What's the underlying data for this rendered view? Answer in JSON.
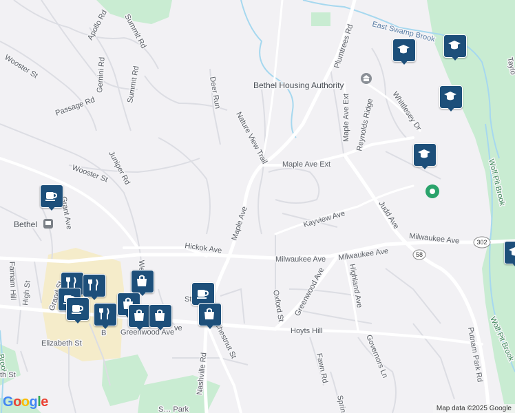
{
  "map": {
    "street_labels": {
      "plumtrees_rd": "Plumtrees Rd",
      "east_swamp_brook": "East Swamp Brook",
      "taylor_rd": "Taylo",
      "apollo_rd": "Apollo Rd",
      "summit_rd_1": "Summit Rd",
      "summit_rd_2": "Summit Rd",
      "gemini_rd": "Gemini Rd",
      "wooster_st_1": "Wooster St",
      "passage_rd": "Passage Rd",
      "deer_run": "Deer Run",
      "nature_view_trail": "Nature View Trail",
      "maple_ave_ext_1": "Maple Ave Ext",
      "maple_ave_ext_2": "Maple Ave Ext",
      "reynolds_ridge": "Reynolds Ridge",
      "whittlesey_dr": "Whittlesey Dr",
      "juniper_rd": "Juniper Rd",
      "wooster_st_2": "Wooster St",
      "grant_ave": "Grant Ave",
      "maple_ave": "Maple Ave",
      "kayview_ave": "Kayview Ave",
      "judd_ave": "Judd Ave",
      "wolf_pit_brook_1": "Wolf Pit Brook",
      "wolf_pit_brook_2": "Wolf Pit Brook",
      "hickok_ave": "Hickok Ave",
      "milwaukee_ave_1": "Milwaukee Ave",
      "milwaukee_ave_2": "Milwaukee Ave",
      "milwaukee_ave_3": "Milwaukee Ave",
      "highland_ave": "Highland Ave",
      "greenwood_ave_1": "Greenwood Ave",
      "greenwood_ave_2": "Greenwood Ave",
      "oxford_st": "Oxford St",
      "farnam_hill": "Farnam Hill",
      "high_st": "High St",
      "grand_st": "Grand St",
      "chestnut_st": "Chestnut St",
      "hoyts_hill": "Hoyts Hill",
      "putnam_park_rd": "Putnam Park Rd",
      "elizabeth_st": "Elizabeth St",
      "nashville_rd": "Nashville Rd",
      "fawn_rd": "Fawn Rd",
      "governors_ln": "Governors Ln",
      "spring": "Spring",
      "brook_left": "Brook",
      "th_st": "th St",
      "we": "We",
      "st_fragment": "St",
      "ave_fragment": "ve",
      "bethel_fragment": "B",
      "bottom_fragment": "S… Park"
    },
    "poi_labels": {
      "bethel_housing_authority": "Bethel Housing Authority",
      "bethel": "Bethel"
    },
    "route_shields": {
      "r302": "302",
      "r58": "58"
    },
    "colors": {
      "background": "#f2f1f4",
      "road": "#ffffff",
      "road_minor": "#dcdde3",
      "park": "#c9ecd2",
      "water": "#a6d8ef",
      "marker": "#1d4f7a",
      "town_yellow": "#f8e8a8"
    },
    "markers": [
      {
        "type": "school",
        "icon": "graduation-cap-icon"
      },
      {
        "type": "school",
        "icon": "graduation-cap-icon"
      },
      {
        "type": "school",
        "icon": "graduation-cap-icon"
      },
      {
        "type": "school",
        "icon": "graduation-cap-icon"
      },
      {
        "type": "school",
        "icon": "graduation-cap-icon"
      },
      {
        "type": "cafe",
        "icon": "coffee-cup-icon"
      },
      {
        "type": "restaurant",
        "icon": "fork-knife-icon"
      },
      {
        "type": "shopping",
        "icon": "shopping-bag-icon"
      },
      {
        "type": "cafe",
        "icon": "coffee-cup-icon"
      },
      {
        "type": "shopping",
        "icon": "shopping-bag-icon"
      },
      {
        "type": "shopping",
        "icon": "shopping-bag-icon"
      }
    ]
  },
  "footer": {
    "logo": "Google",
    "attribution": "Map data ©2025 Google"
  }
}
